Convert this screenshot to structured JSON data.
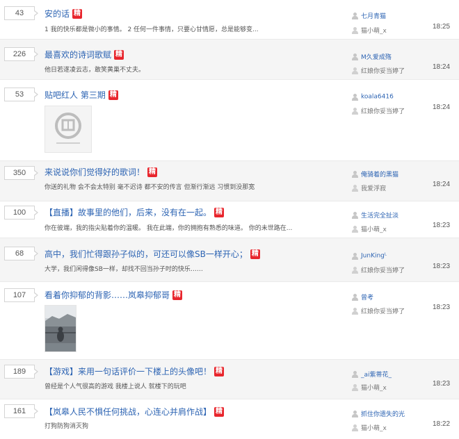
{
  "threads": [
    {
      "replies": "43",
      "title": "安的话",
      "badge": "精",
      "snippet": "1 我的快乐都是微小的事情。               2 任何一件事情，只要心甘情愿，总是能够变...",
      "author": "七月青猫",
      "last_reply": "猫小萌_x",
      "time": "18:25",
      "thumb": null
    },
    {
      "replies": "226",
      "title": "最喜欢的诗词歌赋",
      "badge": "精",
      "snippet": "他日若遂凌云志，敢笑黄巢不丈夫。",
      "author": "M久爱成殇",
      "last_reply": "红娘你妥当婷了",
      "time": "18:24",
      "thumb": null
    },
    {
      "replies": "53",
      "title": "贴吧红人 第三期",
      "badge": "精",
      "snippet": "",
      "author": "koala6416",
      "last_reply": "红娘你妥当婷了",
      "time": "18:24",
      "thumb": "logo"
    },
    {
      "replies": "350",
      "title": "来说说你们觉得好的歌词！",
      "badge": "精",
      "snippet": "你送的礼物 会不会太特别 毫不迟诗 都不安的传言 但渐行渐远 习惯到没那宽",
      "author": "俺骑着的黑猫",
      "last_reply": "我爱浮寂",
      "time": "18:24",
      "thumb": null
    },
    {
      "replies": "100",
      "title": "【直播】故事里的他们，后来，没有在一起。",
      "badge": "精",
      "snippet": "你在彼端，我的指尖贴着你的温暖。 我在此端，你的拥抱有熟悉的味道。 你的未世路在...",
      "author": "生活完全扯淡",
      "last_reply": "猫小萌_x",
      "time": "18:23",
      "thumb": null
    },
    {
      "replies": "68",
      "title": "高中，我们忙得跟孙子似的，可还可以像SB一样开心；",
      "badge": "精",
      "snippet": "大学，我们闲得像SB一样，却找不回当孙子时的快乐……",
      "author": "JunKingᴸ",
      "last_reply": "红娘你妥当婷了",
      "time": "18:23",
      "thumb": null
    },
    {
      "replies": "107",
      "title": "看着你抑郁的背影……岚皋抑郁哥",
      "badge": "精",
      "snippet": "",
      "author": "曾考",
      "last_reply": "红娘你妥当婷了",
      "time": "18:23",
      "thumb": "photo"
    },
    {
      "replies": "189",
      "title": "【游戏】来用一句话评价一下楼上的头像吧！",
      "badge": "精",
      "snippet": "曾经是个人气很高的游戏 我楼上说人 就楼下的玩吧",
      "author": "_ai紫蒂花_",
      "last_reply": "猫小萌_x",
      "time": "18:23",
      "thumb": null
    },
    {
      "replies": "161",
      "title": "【岚皋人民不惧任何挑战，心连心并肩作战】",
      "badge": "精",
      "snippet": "打狗防狗消灭狗",
      "author": "抓住你遗失的光",
      "last_reply": "猫小萌_x",
      "time": "18:22",
      "thumb": null
    }
  ],
  "icons": {
    "author": "user-icon",
    "last_reply": "user-icon"
  },
  "colors": {
    "link": "#2d64b3",
    "badge": "#e8262d",
    "alt_row": "#f5f5f5"
  }
}
